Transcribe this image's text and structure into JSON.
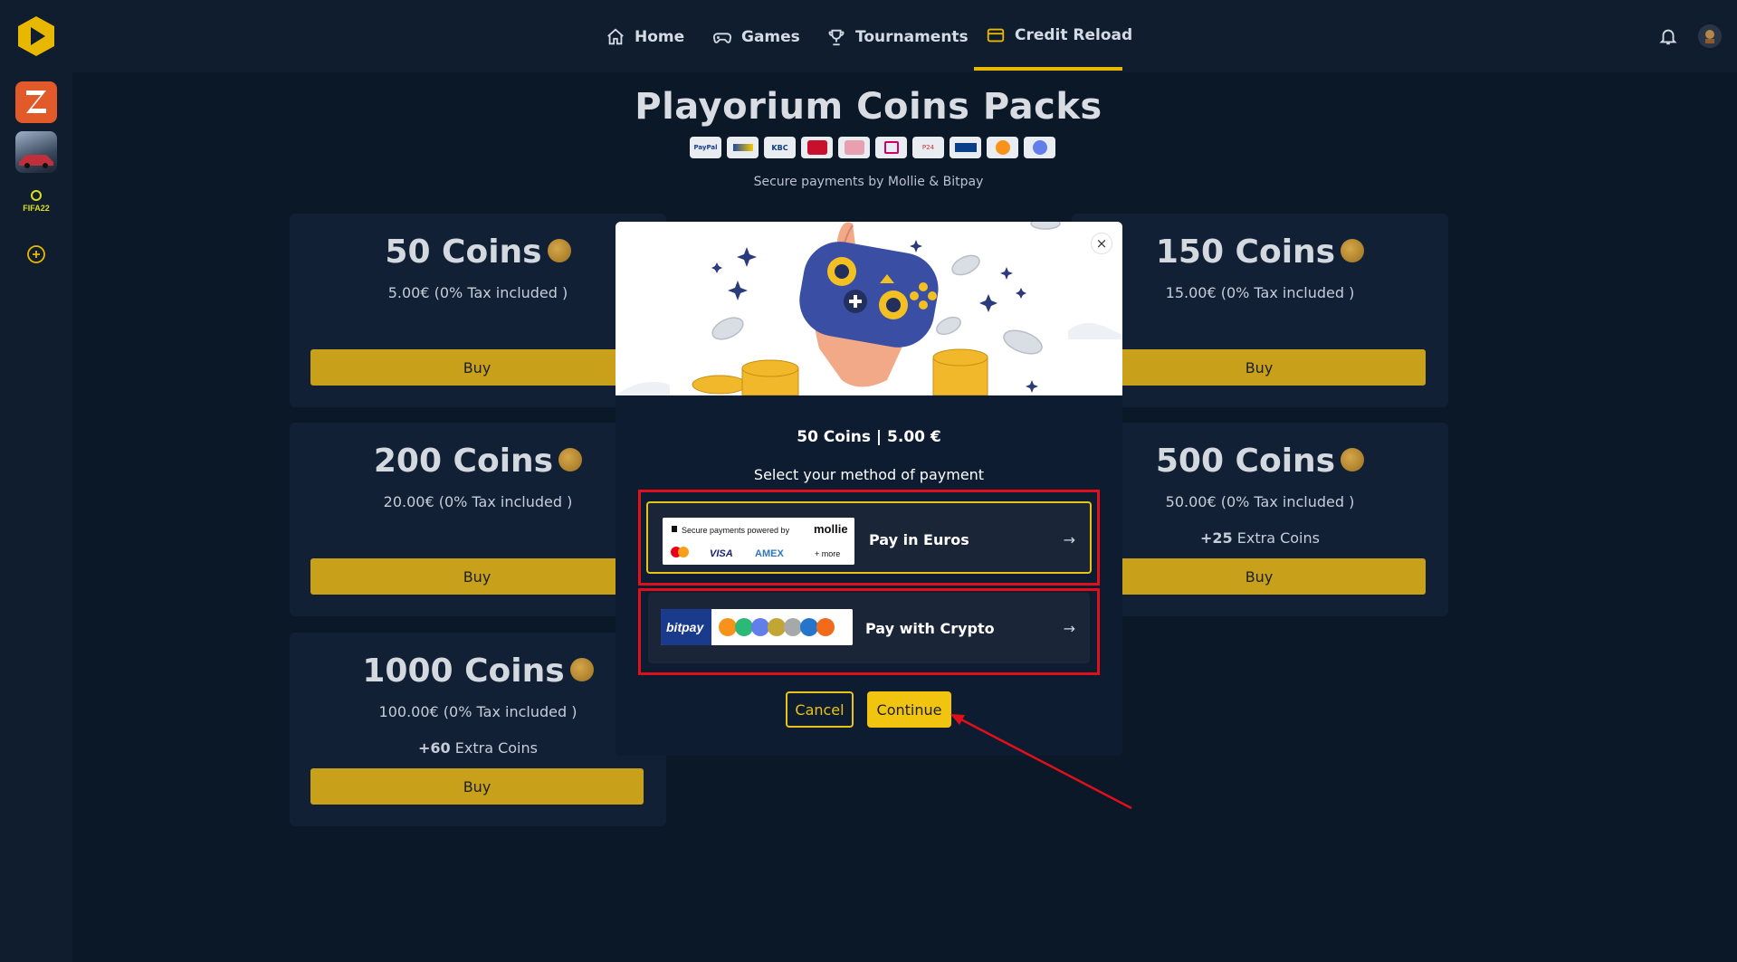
{
  "nav": {
    "items": [
      {
        "label": "Home",
        "icon": "home-icon"
      },
      {
        "label": "Games",
        "icon": "gamepad-icon"
      },
      {
        "label": "Tournaments",
        "icon": "trophy-icon"
      },
      {
        "label": "Credit Reload",
        "icon": "credit-card-icon",
        "active": true
      }
    ]
  },
  "sidebar": {
    "games": [
      {
        "label": "ZWIFT"
      },
      {
        "label": ""
      },
      {
        "label": "FIFA22"
      }
    ]
  },
  "page": {
    "title": "Playorium Coins Packs",
    "secure_text": "Secure payments by Mollie & Bitpay",
    "payment_methods": [
      "PayPal",
      "Bancontact",
      "KBC",
      "Belfius",
      "Sofort",
      "iDEAL",
      "Przelewy24",
      "Giropay",
      "Bitcoin",
      "Ethereum"
    ]
  },
  "packs": [
    {
      "title": "50 Coins",
      "price": "5.00€ (0% Tax included )",
      "extra_num": "",
      "extra_text": "",
      "buy": "Buy"
    },
    {
      "title": "150 Coins",
      "price": "15.00€ (0% Tax included )",
      "extra_num": "",
      "extra_text": "",
      "buy": "Buy"
    },
    {
      "title": "200 Coins",
      "price": "20.00€ (0% Tax included )",
      "extra_num": "",
      "extra_text": "",
      "buy": "Buy"
    },
    {
      "title": "500 Coins",
      "price": "50.00€ (0% Tax included )",
      "extra_num": "+25",
      "extra_text": " Extra Coins",
      "buy": "Buy"
    },
    {
      "title": "1000 Coins",
      "price": "100.00€ (0% Tax included )",
      "extra_num": "+60",
      "extra_text": " Extra Coins",
      "buy": "Buy"
    }
  ],
  "modal": {
    "close": "×",
    "summary": "50 Coins | 5.00 €",
    "select_label": "Select your method of payment",
    "options": [
      {
        "label": "Pay in Euros",
        "arrow": "→",
        "logo_top": "Secure payments powered by",
        "logo_brand": "mollie",
        "logo_cards": [
          "VISA",
          "AMEX",
          "+ more"
        ]
      },
      {
        "label": "Pay with Crypto",
        "arrow": "→",
        "logo_brand": "bitpay"
      }
    ],
    "cancel": "Cancel",
    "continue": "Continue"
  },
  "colors": {
    "accent": "#e8c318",
    "annotation": "#e0101a",
    "background": "#0b1828",
    "card": "#112035"
  }
}
